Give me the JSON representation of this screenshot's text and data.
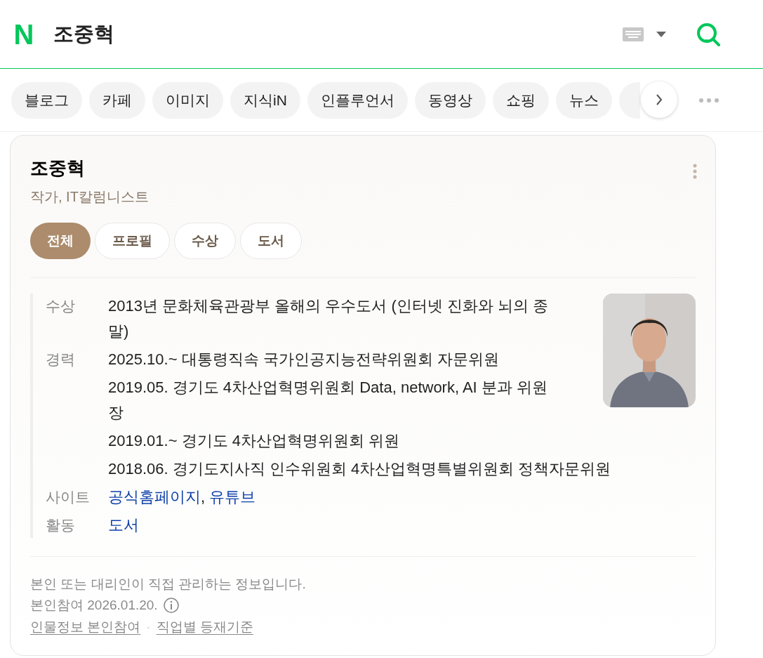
{
  "header": {
    "logo": "N",
    "query": "조중혁"
  },
  "chips": [
    {
      "label": "블로그"
    },
    {
      "label": "카페"
    },
    {
      "label": "이미지"
    },
    {
      "label": "지식iN"
    },
    {
      "label": "인플루언서"
    },
    {
      "label": "동영상"
    },
    {
      "label": "쇼핑"
    },
    {
      "label": "뉴스"
    }
  ],
  "card": {
    "name": "조중혁",
    "subtitle": "작가, IT칼럼니스트",
    "tabs": [
      {
        "label": "전체",
        "selected": true
      },
      {
        "label": "프로필",
        "selected": false
      },
      {
        "label": "수상",
        "selected": false
      },
      {
        "label": "도서",
        "selected": false
      }
    ],
    "info": [
      {
        "label": "수상",
        "kind": "text",
        "values": [
          "2013년 문화체육관광부 올해의 우수도서 (인터넷 진화와 뇌의 종말)"
        ]
      },
      {
        "label": "경력",
        "kind": "text",
        "values": [
          "2025.10.~ 대통령직속 국가인공지능전략위원회 자문위원",
          "2019.05. 경기도 4차산업혁명위원회 Data, network, AI 분과 위원장",
          "2019.01.~ 경기도 4차산업혁명위원회 위원",
          "2018.06. 경기도지사직 인수위원회 4차산업혁명특별위원회 정책자문위원"
        ]
      },
      {
        "label": "사이트",
        "kind": "links",
        "values": [
          "공식홈페이지",
          "유튜브"
        ],
        "separator": ","
      },
      {
        "label": "활동",
        "kind": "links",
        "values": [
          "도서"
        ]
      }
    ],
    "footer": {
      "note": "본인 또는 대리인이 직접 관리하는 정보입니다.",
      "date": "본인참여 2026.01.20.",
      "links": [
        "인물정보 본인참여",
        "직업별 등재기준"
      ],
      "separator": "·"
    }
  }
}
